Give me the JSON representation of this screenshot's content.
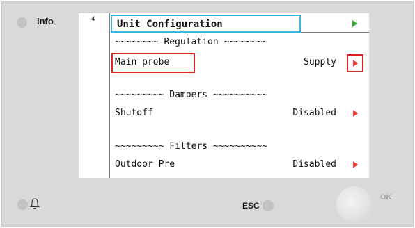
{
  "panel": {
    "info_label": "Info",
    "esc_label": "ESC",
    "ok_label": "OK"
  },
  "screen": {
    "page_number": "4",
    "title": "Unit Configuration",
    "sections": [
      {
        "heading": "~~~~~~~~ Regulation ~~~~~~~~",
        "label": "Main probe",
        "value": "Supply"
      },
      {
        "heading": "~~~~~~~~~ Dampers ~~~~~~~~~~",
        "label": "Shutoff",
        "value": "Disabled"
      },
      {
        "heading": "~~~~~~~~~ Filters ~~~~~~~~~~",
        "label": "Outdoor Pre",
        "value": "Disabled"
      }
    ]
  },
  "colors": {
    "title_highlight": "#3fb3e3",
    "selection_highlight": "#e02424",
    "arrow_red": "#ee3a3a",
    "arrow_green": "#35a636"
  },
  "icons": [
    "info-led-icon",
    "bell-icon",
    "esc-led-icon",
    "ok-knob"
  ]
}
